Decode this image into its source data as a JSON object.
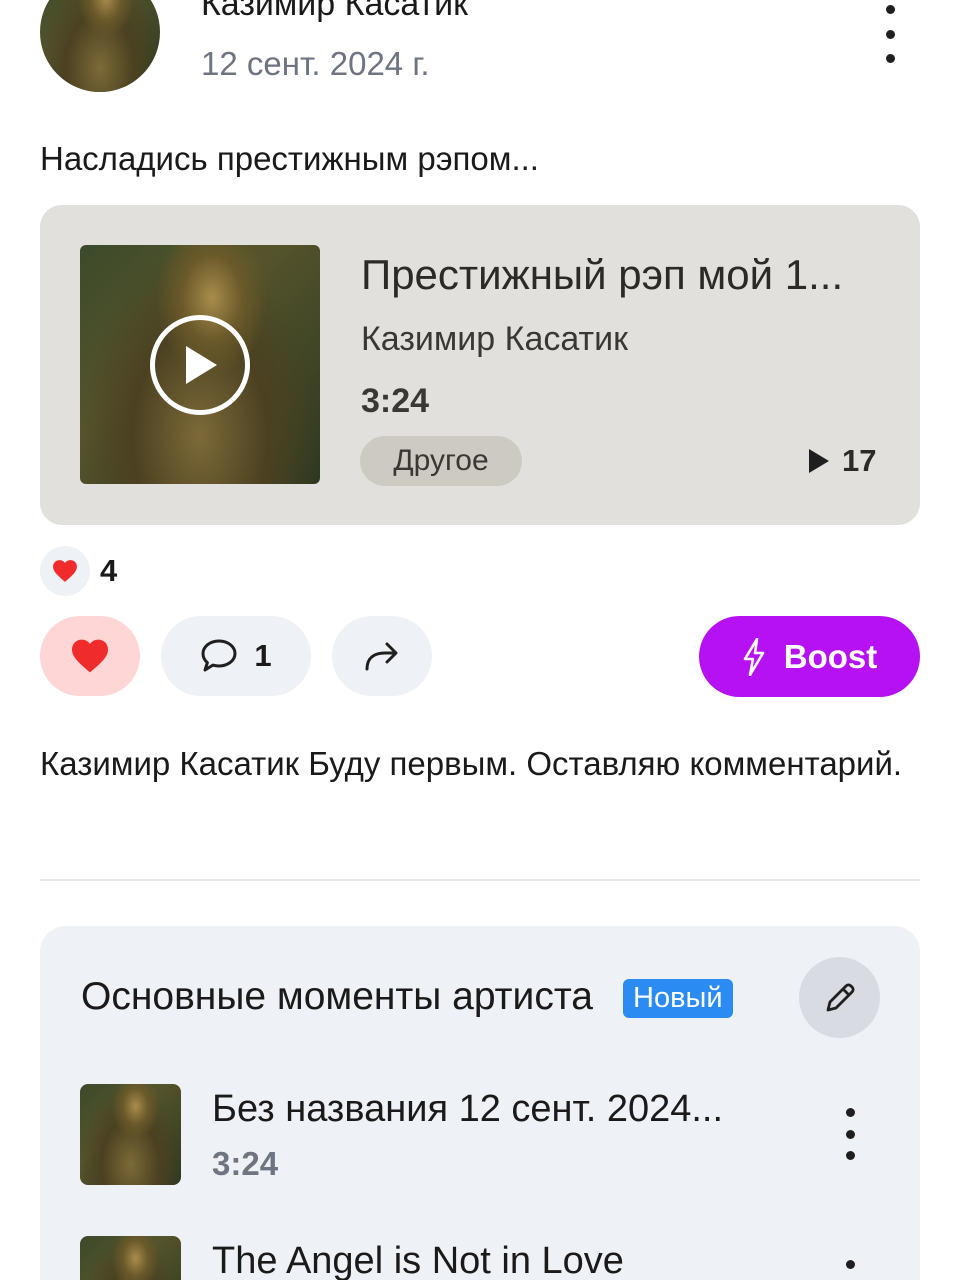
{
  "post": {
    "author_name": "Казимир Касатик",
    "date": "12 сент. 2024 г.",
    "text": "Насладись престижным рэпом..."
  },
  "track": {
    "title": "Престижный рэп мой 1...",
    "artist": "Казимир Касатик",
    "duration": "3:24",
    "genre": "Другое",
    "plays": "17"
  },
  "reactions": {
    "count": "4"
  },
  "actions": {
    "comments_count": "1",
    "boost_label": "Boost"
  },
  "comment": {
    "text": "Казимир Касатик Буду первым. Оставляю комментарий."
  },
  "highlights": {
    "title": "Основные моменты артиста",
    "badge": "Новый",
    "items": [
      {
        "title": "Без названия 12 сент. 2024...",
        "duration": "3:24"
      },
      {
        "title": "The Angel is Not in Love",
        "duration": ""
      }
    ]
  },
  "colors": {
    "boost": "#b511f2",
    "like": "#ef2b2b",
    "badge": "#2a8bf2"
  }
}
